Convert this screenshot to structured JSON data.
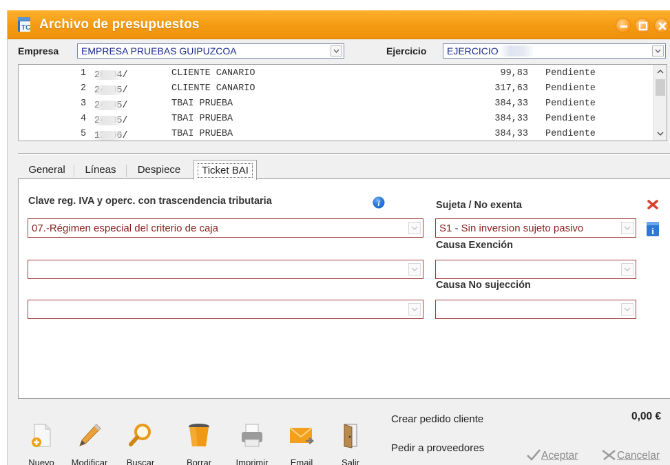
{
  "window": {
    "title": "Archivo de presupuestos"
  },
  "header": {
    "empresa_label": "Empresa",
    "empresa_value": "EMPRESA PRUEBAS GUIPUZCOA",
    "ejercicio_label": "Ejercicio",
    "ejercicio_value": "EJERCICIO"
  },
  "list": {
    "rows": [
      {
        "num": "1",
        "date": "26/04/",
        "client": "CLIENTE CANARIO",
        "amount": "99,83",
        "status": "Pendiente"
      },
      {
        "num": "2",
        "date": "24/05/",
        "client": "CLIENTE CANARIO",
        "amount": "317,63",
        "status": "Pendiente"
      },
      {
        "num": "3",
        "date": "24/05/",
        "client": "TBAI PRUEBA",
        "amount": "384,33",
        "status": "Pendiente"
      },
      {
        "num": "4",
        "date": "24/05/",
        "client": "TBAI PRUEBA",
        "amount": "384,33",
        "status": "Pendiente"
      },
      {
        "num": "5",
        "date": "12/06/",
        "client": "TBAI PRUEBA",
        "amount": "384,33",
        "status": "Pendiente"
      }
    ]
  },
  "tabs": [
    {
      "label": "General"
    },
    {
      "label": "Líneas"
    },
    {
      "label": "Despiece"
    },
    {
      "label": "Ticket BAI"
    }
  ],
  "ticketbai": {
    "clave_label": "Clave reg. IVA y operc. con trascendencia tributaria",
    "clave_value_1": "07.-Régimen especial del criterio de caja",
    "clave_value_2": "",
    "clave_value_3": "",
    "sujeta_label": "Sujeta / No exenta",
    "sujeta_value": "S1 - Sin inversion sujeto pasivo",
    "causa_exencion_label": "Causa Exención",
    "causa_exencion_value": "",
    "causa_no_sujeccion_label": "Causa No sujección",
    "causa_no_sujeccion_value": ""
  },
  "toolbar": {
    "nuevo": "Nuevo",
    "modificar": "Modificar",
    "buscar": "Buscar",
    "borrar": "Borrar",
    "imprimir": "Imprimir",
    "email": "Email",
    "salir": "Salir"
  },
  "footer": {
    "crear_pedido": "Crear pedido cliente",
    "pedir_proveedores": "Pedir a proveedores",
    "total": "0,00 €",
    "aceptar": "Aceptar",
    "cancelar": "Cancelar"
  },
  "colors": {
    "titlebar": "#f39a12",
    "field_border": "#a03b3b",
    "field_text": "#8a1e1e",
    "header_value": "#1a2a8a"
  }
}
